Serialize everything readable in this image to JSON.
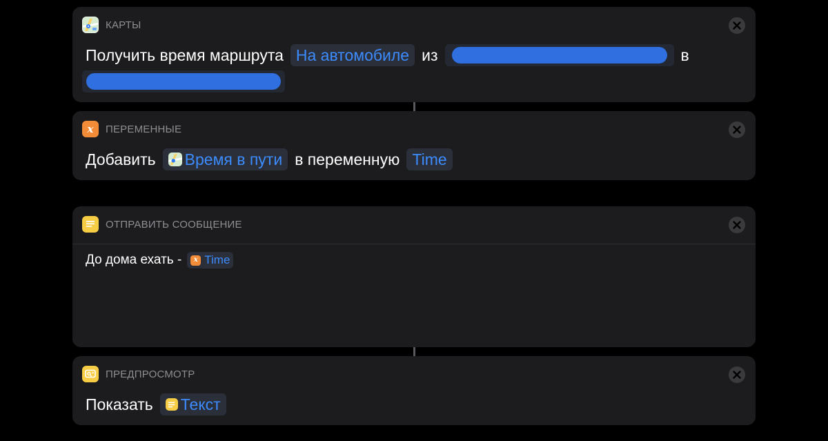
{
  "theme": {
    "background": "#000000",
    "card": "#1c1c1e",
    "accent": "#3d8cff",
    "muted": "#8e8e93",
    "redaction": "#2f6fe0"
  },
  "actions": [
    {
      "app": "КАРТЫ",
      "icon": "maps-icon",
      "text_1": "Получить время маршрута",
      "mode_token": "На автомобиле",
      "text_2": "из",
      "text_3": "в",
      "from_value": "[redacted]",
      "to_value": "[redacted]"
    },
    {
      "app": "ПЕРЕМЕННЫЕ",
      "icon": "variable-icon",
      "text_1": "Добавить",
      "value_token": "Время в пути",
      "text_2": "в переменную",
      "variable_token": "Time"
    },
    {
      "app": "ОТПРАВИТЬ СООБЩЕНИЕ",
      "icon": "notes-icon",
      "message_text": "До дома ехать -",
      "variable_token": "Time"
    },
    {
      "app": "ПРЕДПРОСМОТР",
      "icon": "preview-icon",
      "text_1": "Показать",
      "value_token": "Текст"
    }
  ]
}
